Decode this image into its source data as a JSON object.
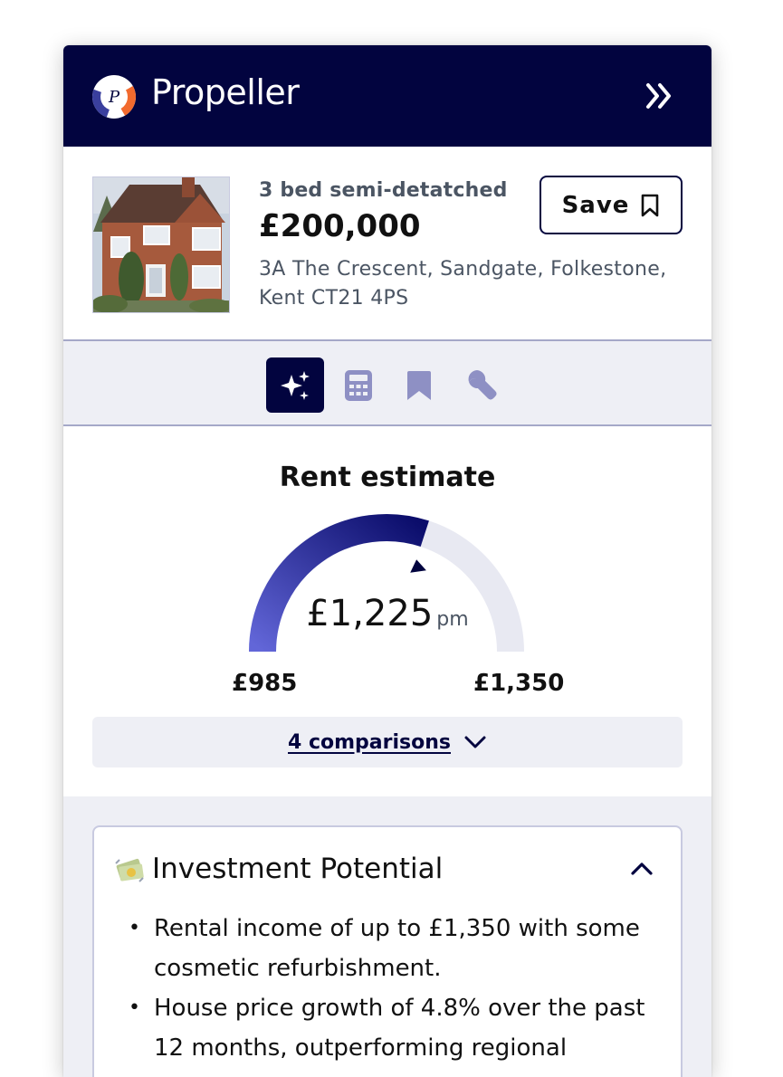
{
  "header": {
    "brand": "Propeller",
    "colors": {
      "navy": "#02043f",
      "accent": "#5b5fd6",
      "orange": "#f26a2e"
    }
  },
  "property": {
    "type": "3 bed semi-detatched",
    "price": "£200,000",
    "address": "3A The Crescent, Sandgate, Folkestone, Kent CT21 4PS",
    "save_label": "Save"
  },
  "tools": [
    {
      "icon": "sparkles-icon",
      "active": true
    },
    {
      "icon": "calculator-icon",
      "active": false
    },
    {
      "icon": "bookmark-icon",
      "active": false
    },
    {
      "icon": "wrench-icon",
      "active": false
    }
  ],
  "rent": {
    "title": "Rent estimate",
    "amount": "£1,225",
    "unit": "pm",
    "min": "£985",
    "max": "£1,350",
    "gauge_fraction": 0.6,
    "comparisons_label": "4 comparisons"
  },
  "investment": {
    "icon": "money-icon",
    "title": "Investment Potential",
    "bullets": [
      "Rental income of up to £1,350 with some cosmetic refurbishment.",
      "House price growth of 4.8% over the past 12 months, outperforming regional"
    ]
  }
}
